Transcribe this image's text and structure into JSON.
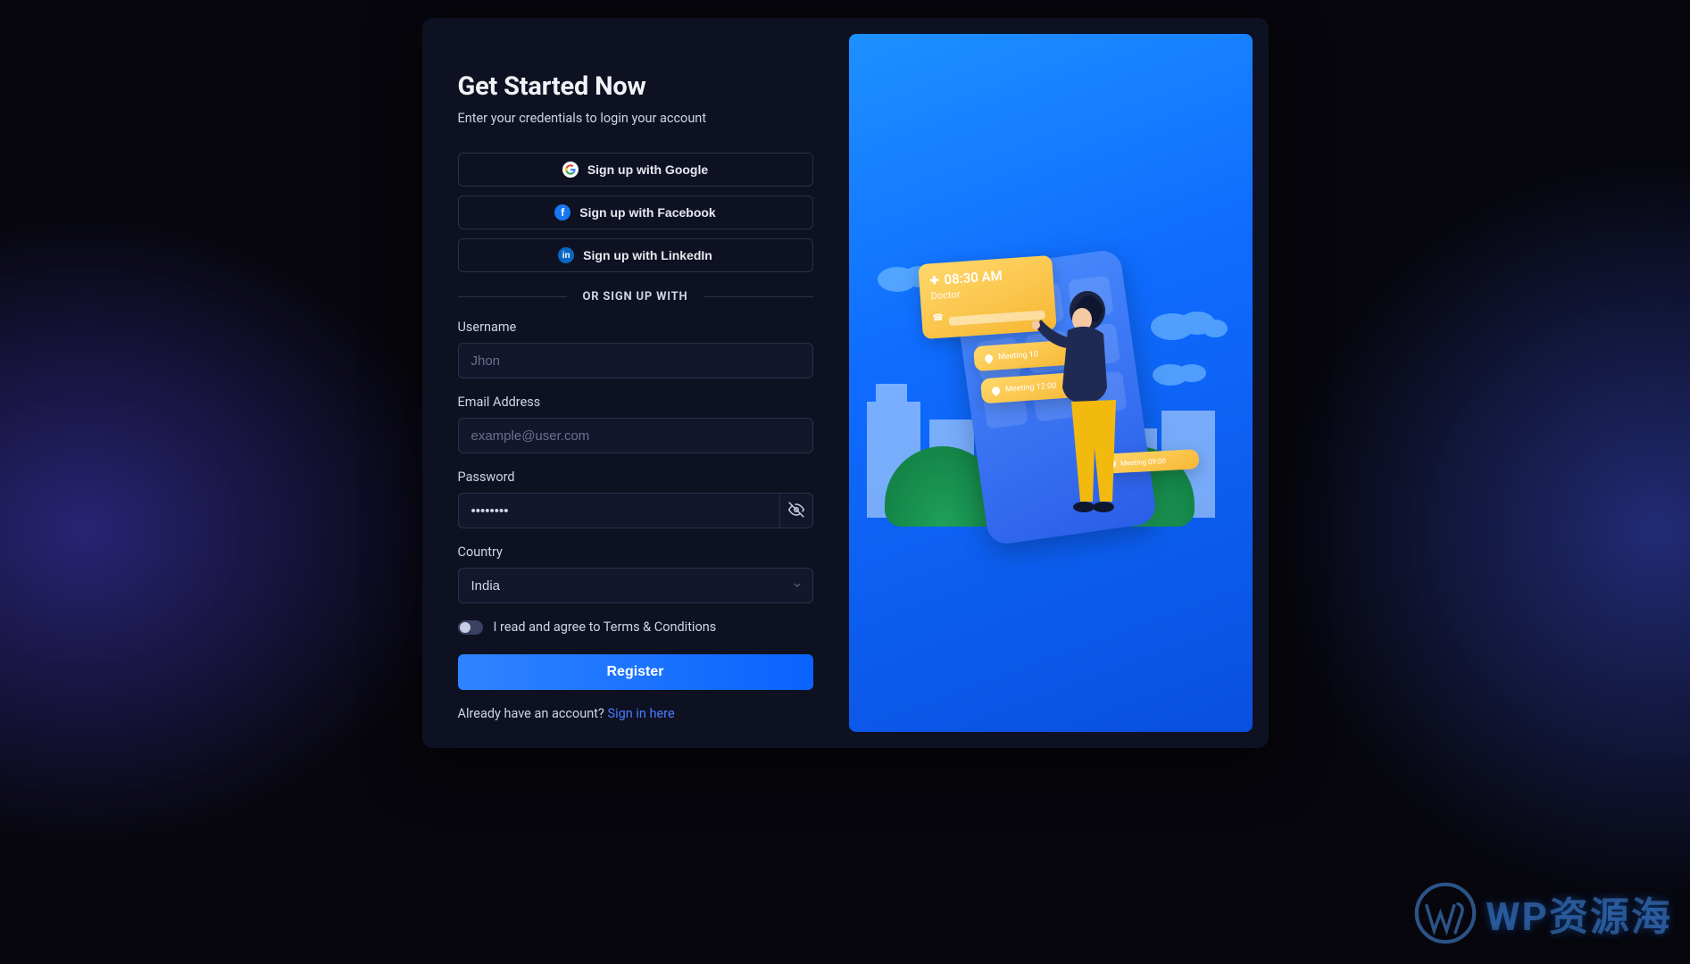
{
  "header": {
    "title": "Get Started Now",
    "subtitle": "Enter your credentials to login your account"
  },
  "social": {
    "google": "Sign up with Google",
    "facebook": "Sign up with Facebook",
    "linkedin": "Sign up with LinkedIn"
  },
  "divider": "OR SIGN UP WITH",
  "form": {
    "username_label": "Username",
    "username_placeholder": "Jhon",
    "email_label": "Email Address",
    "email_placeholder": "example@user.com",
    "password_label": "Password",
    "password_value": "••••••••",
    "country_label": "Country",
    "country_value": "India",
    "terms_text": "I read and agree to Terms & Conditions",
    "register": "Register"
  },
  "footer": {
    "prompt": "Already have an account? ",
    "link": "Sign in here"
  },
  "illustration": {
    "card_time": "08:30 AM",
    "card_sub": "Doctor",
    "meeting1": "Meeting 10",
    "meeting2": "Meeting 12:00",
    "meeting3": "Meeting 09:00"
  },
  "watermark": "WP资源海"
}
